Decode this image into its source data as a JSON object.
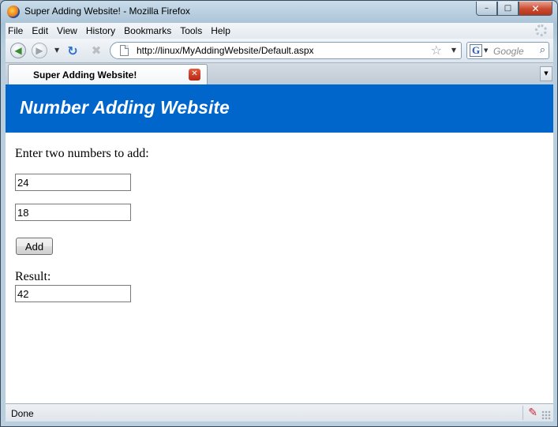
{
  "window": {
    "title": "Super Adding Website! - Mozilla Firefox",
    "buttons": {
      "minimize": "–",
      "maximize": "□",
      "close": "✕"
    }
  },
  "menubar": {
    "items": [
      "File",
      "Edit",
      "View",
      "History",
      "Bookmarks",
      "Tools",
      "Help"
    ]
  },
  "navbar": {
    "url": "http://linux/MyAddingWebsite/Default.aspx",
    "search_placeholder": "Google",
    "search_engine_letter": "G"
  },
  "tabs": [
    {
      "label": "Super Adding Website!"
    }
  ],
  "page": {
    "banner_title": "Number Adding Website",
    "prompt": "Enter two numbers to add:",
    "first_number": "24",
    "second_number": "18",
    "add_button": "Add",
    "result_label": "Result:",
    "result_value": "42",
    "banner_color": "#0066cc"
  },
  "statusbar": {
    "text": "Done"
  }
}
